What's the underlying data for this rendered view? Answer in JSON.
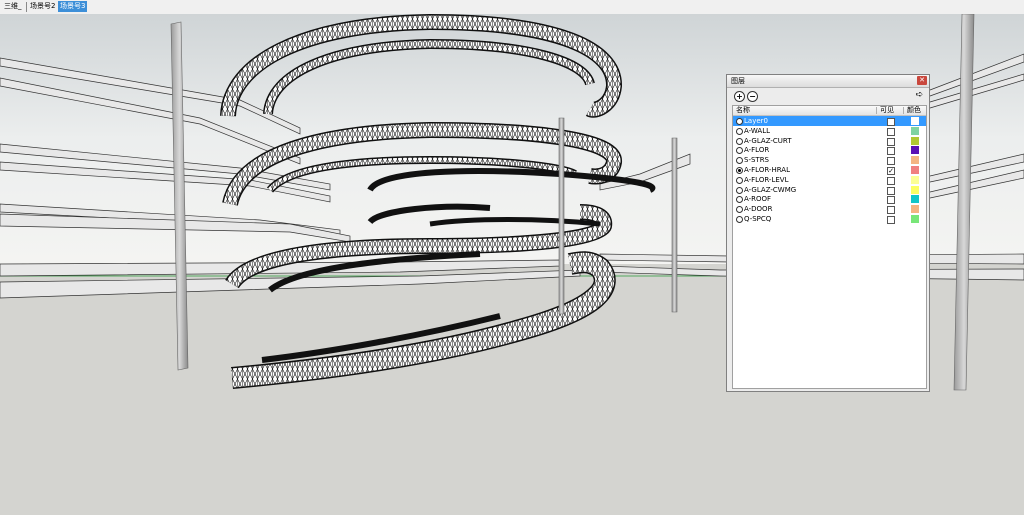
{
  "tabs": [
    {
      "label": "三维_",
      "active": false
    },
    {
      "label": "场景号2",
      "active": false
    },
    {
      "label": "场景号3",
      "active": true
    }
  ],
  "layers_panel": {
    "title": "图层",
    "columns": {
      "name": "名称",
      "visible": "可见",
      "color": "颜色"
    },
    "layers": [
      {
        "name": "Layer0",
        "active": false,
        "visible": false,
        "color": "#ffffff",
        "selected": true
      },
      {
        "name": "A-WALL",
        "active": false,
        "visible": false,
        "color": "#7fd3a2",
        "selected": false
      },
      {
        "name": "A-GLAZ-CURT",
        "active": false,
        "visible": false,
        "color": "#b0c832",
        "selected": false
      },
      {
        "name": "A-FLOR",
        "active": false,
        "visible": false,
        "color": "#5a10b4",
        "selected": false
      },
      {
        "name": "S-STRS",
        "active": false,
        "visible": false,
        "color": "#f4b482",
        "selected": false
      },
      {
        "name": "A-FLOR-HRAL",
        "active": true,
        "visible": true,
        "color": "#f08080",
        "selected": false
      },
      {
        "name": "A-FLOR-LEVL",
        "active": false,
        "visible": false,
        "color": "#fcff96",
        "selected": false
      },
      {
        "name": "A-GLAZ-CWMG",
        "active": false,
        "visible": false,
        "color": "#fcff64",
        "selected": false
      },
      {
        "name": "A-ROOF",
        "active": false,
        "visible": false,
        "color": "#12c6c8",
        "selected": false
      },
      {
        "name": "A-DOOR",
        "active": false,
        "visible": false,
        "color": "#f4b482",
        "selected": false
      },
      {
        "name": "Q-SPCQ",
        "active": false,
        "visible": false,
        "color": "#78e678",
        "selected": false
      }
    ]
  },
  "icons": {
    "add": "add-layer-icon",
    "remove": "remove-layer-icon",
    "details": "details-arrow-icon",
    "close": "close-icon"
  }
}
